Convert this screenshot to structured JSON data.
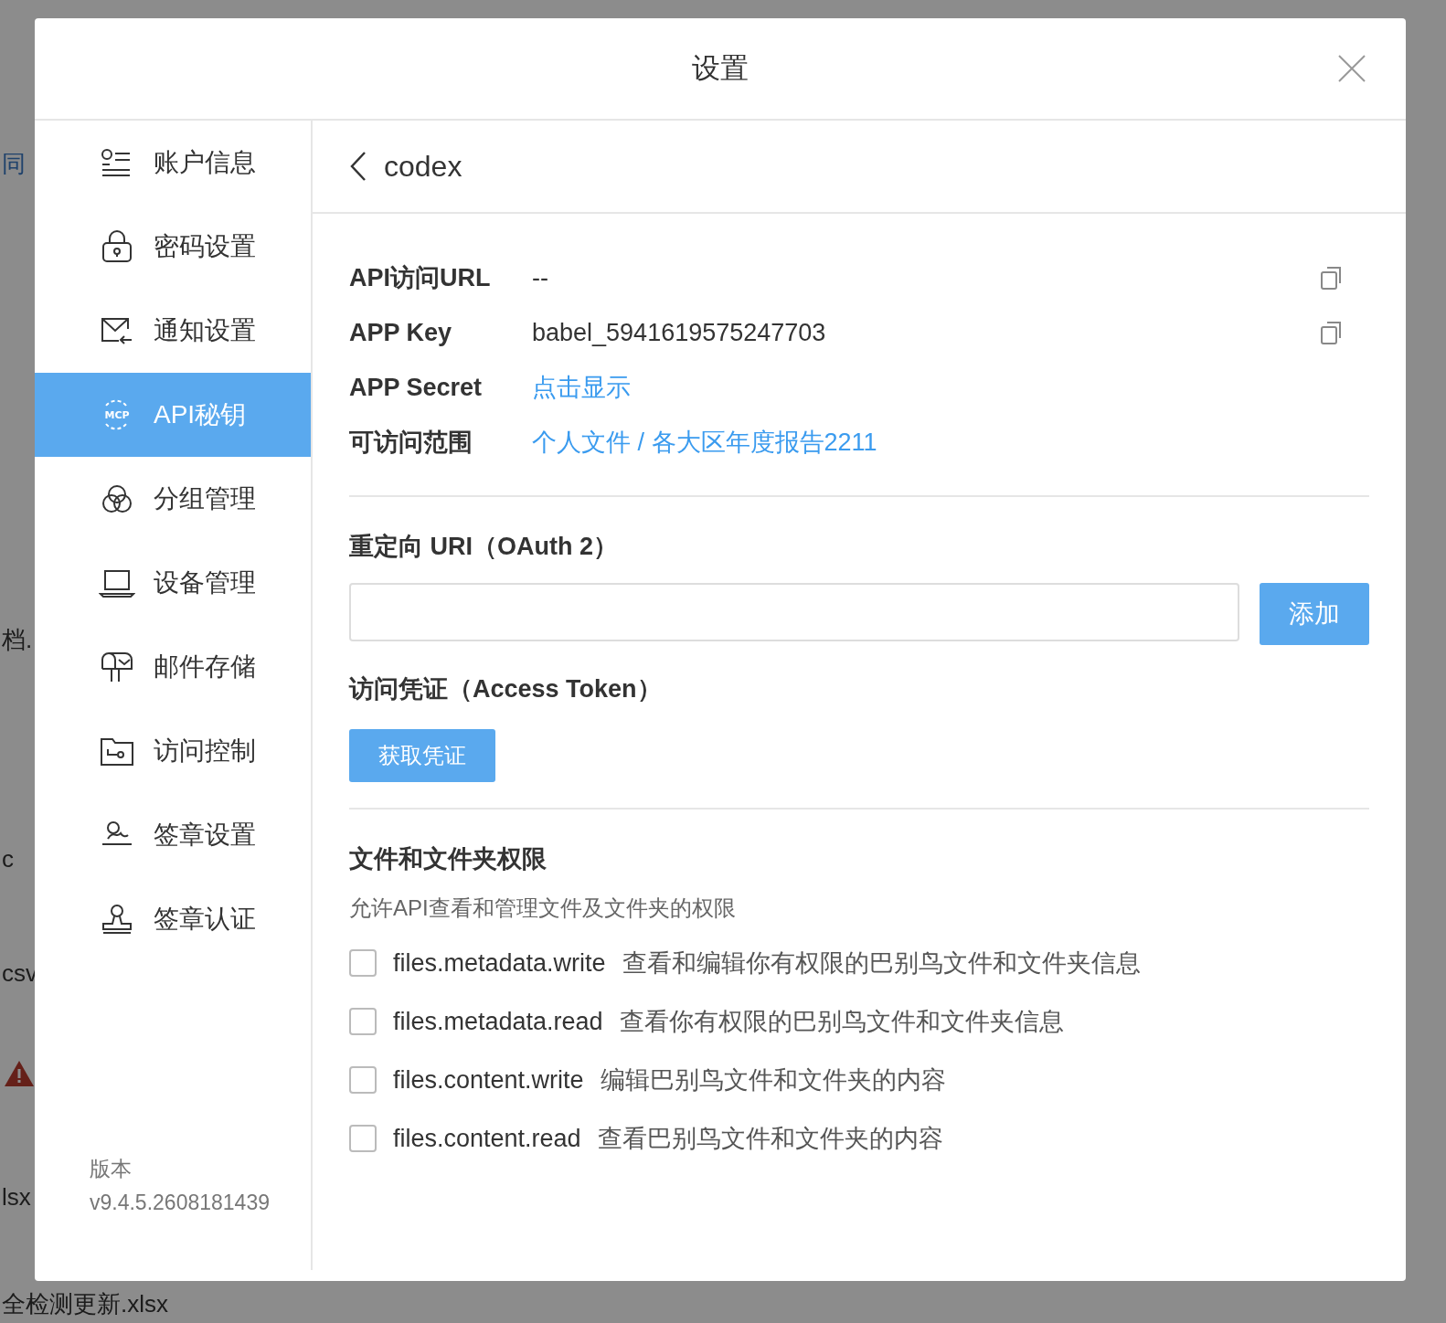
{
  "background": {
    "fragments": [
      {
        "kind": "text",
        "text": "同"
      },
      {
        "kind": "text",
        "text": "档."
      },
      {
        "kind": "text",
        "text": "c"
      },
      {
        "kind": "text",
        "text": "csv"
      },
      {
        "kind": "warning"
      },
      {
        "kind": "text",
        "text": "lsx"
      },
      {
        "kind": "text",
        "text": "全检测更新.xlsx"
      }
    ]
  },
  "dialog": {
    "title": "设置"
  },
  "sidebar": {
    "items": [
      {
        "label": "账户信息",
        "selected": false
      },
      {
        "label": "密码设置",
        "selected": false
      },
      {
        "label": "通知设置",
        "selected": false
      },
      {
        "label": "API秘钥",
        "icon_text": "MCP",
        "selected": true
      },
      {
        "label": "分组管理",
        "selected": false
      },
      {
        "label": "设备管理",
        "selected": false
      },
      {
        "label": "邮件存储",
        "selected": false
      },
      {
        "label": "访问控制",
        "selected": false
      },
      {
        "label": "签章设置",
        "selected": false
      },
      {
        "label": "签章认证",
        "selected": false
      }
    ],
    "version_label": "版本",
    "version": "v9.4.5.2608181439"
  },
  "content": {
    "back_title": "codex",
    "fields": [
      {
        "label": "API访问URL",
        "value": "--",
        "kind": "copy"
      },
      {
        "label": "APP Key",
        "value": "babel_5941619575247703",
        "kind": "copy"
      },
      {
        "label": "APP Secret",
        "value": "点击显示",
        "kind": "link"
      },
      {
        "label": "可访问范围",
        "value": "个人文件 / 各大区年度报告2211",
        "kind": "link"
      }
    ],
    "redirect": {
      "title": "重定向 URI（OAuth 2）",
      "button": "添加"
    },
    "token": {
      "title": "访问凭证（Access Token）",
      "button": "获取凭证"
    },
    "permissions": {
      "title": "文件和文件夹权限",
      "description": "允许API查看和管理文件及文件夹的权限",
      "items": [
        {
          "scope": "files.metadata.write",
          "description": "查看和编辑你有权限的巴别鸟文件和文件夹信息",
          "checked": false
        },
        {
          "scope": "files.metadata.read",
          "description": "查看你有权限的巴别鸟文件和文件夹信息",
          "checked": false
        },
        {
          "scope": "files.content.write",
          "description": "编辑巴别鸟文件和文件夹的内容",
          "checked": false
        },
        {
          "scope": "files.content.read",
          "description": "查看巴别鸟文件和文件夹的内容",
          "checked": false
        }
      ]
    }
  }
}
